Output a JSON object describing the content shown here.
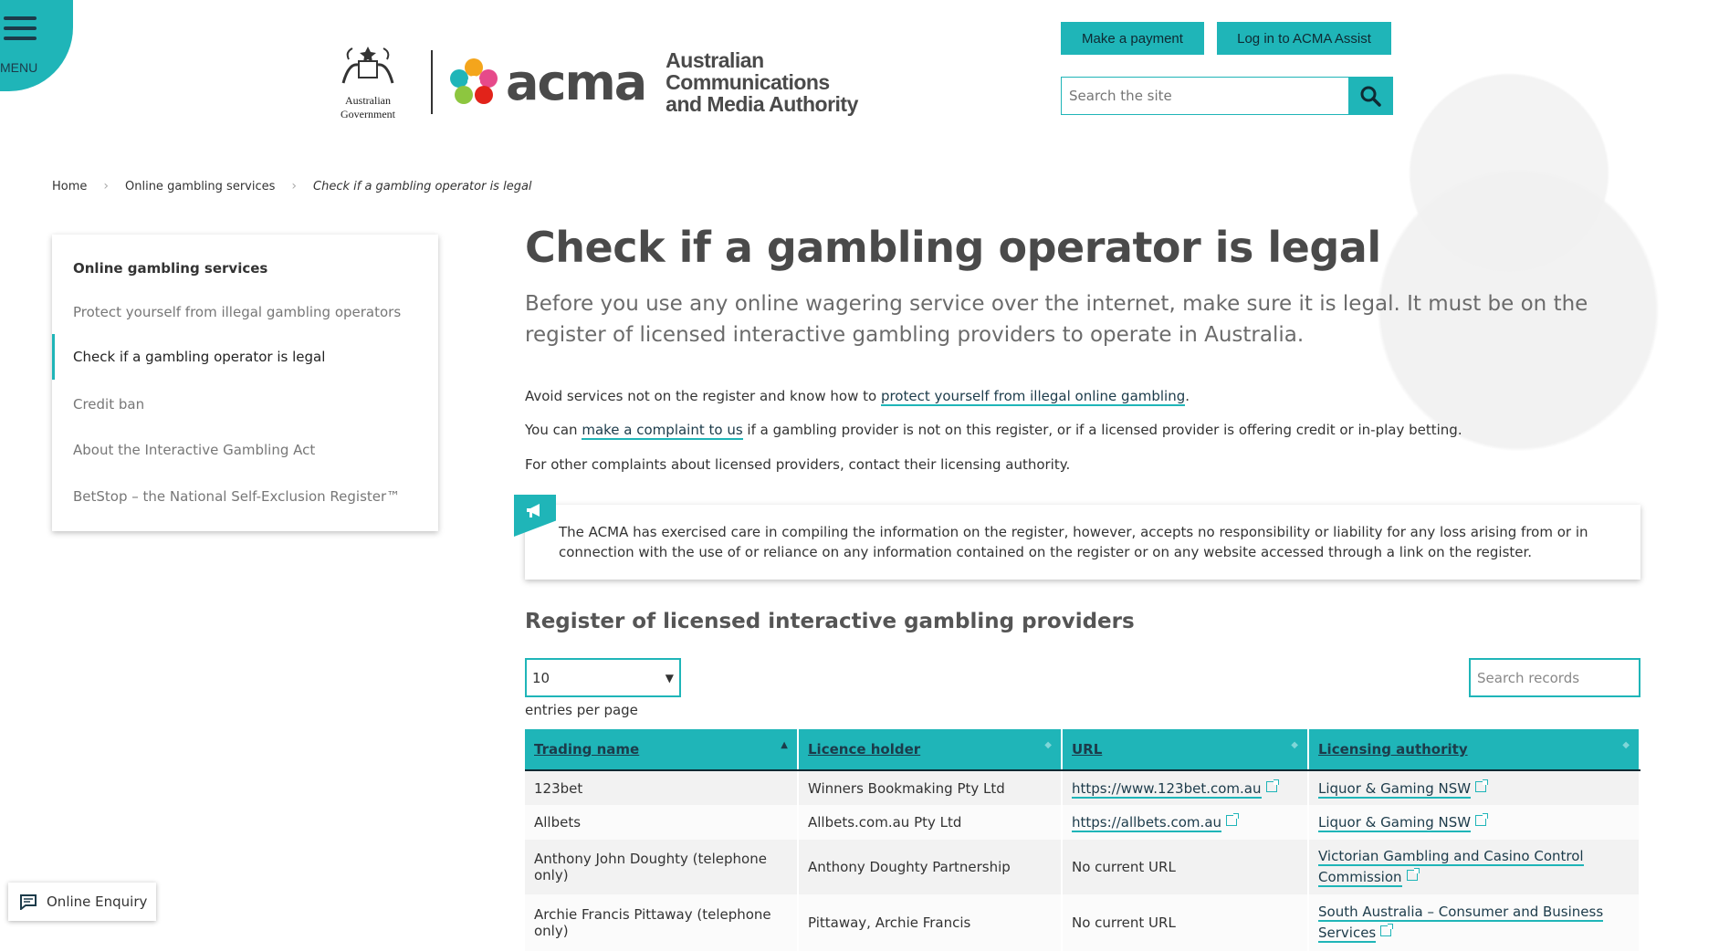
{
  "header": {
    "menu_label": "MENU",
    "gov_label": "Australian Government",
    "brand_short": "acma",
    "brand_full_1": "Australian",
    "brand_full_2": "Communications",
    "brand_full_3": "and Media Authority",
    "payment_btn": "Make a payment",
    "login_btn": "Log in to ACMA Assist",
    "search_placeholder": "Search the site"
  },
  "breadcrumb": [
    "Home",
    "Online gambling services",
    "Check if a gambling operator is legal"
  ],
  "sidebar": {
    "heading": "Online gambling services",
    "items": [
      {
        "label": "Protect yourself from illegal gambling operators"
      },
      {
        "label": "Check if a gambling operator is legal"
      },
      {
        "label": "Credit ban"
      },
      {
        "label": "About the Interactive Gambling Act"
      },
      {
        "label": "BetStop – the National Self-Exclusion Register™"
      }
    ]
  },
  "main": {
    "title": "Check if a gambling operator is legal",
    "lead": "Before you use any online wagering service over the internet, make sure it is legal. It must be on the register of licensed interactive gambling providers to operate in Australia.",
    "p1_before": "Avoid services not on the register and know how to ",
    "p1_link": "protect yourself from illegal online gambling",
    "p1_after": ".",
    "p2_before": "You can ",
    "p2_link": "make a complaint to us",
    "p2_after": " if a gambling provider is not on this register, or if a licensed provider is offering credit or in-play betting.",
    "p3": "For other complaints about licensed providers, contact their licensing authority.",
    "notice": "The ACMA has exercised care in compiling the information on the register, however, accepts no responsibility or liability for any loss arising from or in connection with the use of or reliance on any information contained on the register or on any website accessed through a link on the register."
  },
  "register": {
    "heading": "Register of licensed interactive gambling providers",
    "per_page_value": "10",
    "per_page_label": "entries per page",
    "search_placeholder": "Search records",
    "columns": [
      "Trading name",
      "Licence holder",
      "URL",
      "Licensing authority"
    ],
    "rows": [
      {
        "trading": "123bet",
        "holder": "Winners Bookmaking Pty Ltd",
        "url": "https://www.123bet.com.au",
        "authority": "Liquor & Gaming NSW"
      },
      {
        "trading": "Allbets",
        "holder": "Allbets.com.au Pty Ltd",
        "url": "https://allbets.com.au",
        "authority": "Liquor & Gaming NSW"
      },
      {
        "trading": "Anthony John Doughty (telephone only)",
        "holder": "Anthony Doughty Partnership",
        "url": "No current URL",
        "authority_1": "Victorian Gambling and Casino Control",
        "authority_2": "Commission"
      },
      {
        "trading": "Archie Francis Pittaway (telephone only)",
        "holder": "Pittaway, Archie Francis",
        "url": "No current URL",
        "authority_1": "South Australia – Consumer and Business",
        "authority_2": "Services"
      }
    ]
  },
  "enquiry": {
    "label": "Online Enquiry"
  },
  "colors": {
    "accent": "#1fb5b8",
    "dark": "#1c3b4a"
  }
}
